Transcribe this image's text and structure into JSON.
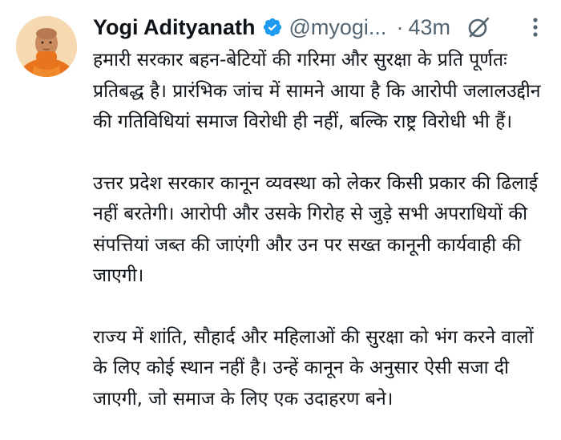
{
  "tweet": {
    "author": {
      "name": "Yogi Adityanath",
      "handle": "@myogi...",
      "verified": true,
      "verified_icon": "verified-badge-icon",
      "verified_color": "#1d9bf0"
    },
    "time_separator": "·",
    "time": "43m",
    "grok_icon": "grok-icon",
    "more_icon": "more-vertical-icon",
    "paragraphs": [
      "हमारी सरकार बहन-बेटियों की गरिमा और सुरक्षा के प्रति पूर्णतः प्रतिबद्ध है। प्रारंभिक जांच में सामने आया है कि आरोपी जलालउद्दीन की गतिविधियां समाज विरोधी ही नहीं, बल्कि राष्ट्र विरोधी भी हैं।",
      "उत्तर प्रदेश सरकार कानून व्यवस्था को लेकर किसी प्रकार की ढिलाई नहीं बरतेगी। आरोपी और उसके गिरोह से जुड़े सभी अपराधियों की संपत्तियां जब्त की जाएंगी और उन पर सख्त कानूनी कार्यवाही की जाएगी।",
      "राज्य में शांति, सौहार्द और महिलाओं की सुरक्षा को भंग करने वालों के लिए कोई स्थान नहीं है। उन्हें कानून के अनुसार ऐसी सजा दी जाएगी, जो समाज के लिए एक उदाहरण बने।"
    ]
  }
}
